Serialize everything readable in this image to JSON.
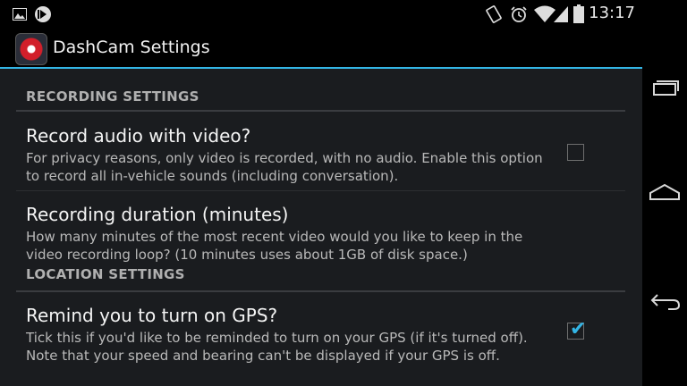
{
  "status_bar": {
    "time": "13:17",
    "left_icons": [
      "image-icon",
      "media-play-icon"
    ],
    "right_icons": [
      "vibrate-icon",
      "alarm-icon",
      "wifi-icon",
      "cell-signal-icon",
      "battery-icon"
    ]
  },
  "action_bar": {
    "title": "DashCam Settings",
    "accent_color": "#33b5e5"
  },
  "sections": {
    "recording": {
      "header": "RECORDING SETTINGS",
      "record_audio": {
        "title": "Record audio with video?",
        "summary": "For privacy reasons, only video is recorded, with no audio. Enable this option to record all in-vehicle sounds (including conversation).",
        "checked": false
      },
      "duration": {
        "title": "Recording duration (minutes)",
        "summary": "How many minutes of the most recent video would you like to keep in the video recording loop? (10 minutes uses about 1GB of disk space.)"
      }
    },
    "location": {
      "header": "LOCATION SETTINGS",
      "gps": {
        "title": "Remind you to turn on GPS?",
        "summary": "Tick this if you'd like to be reminded to turn on your GPS (if it's turned off). Note that your speed and bearing can't be displayed if your GPS is off.",
        "checked": true
      }
    }
  },
  "nav_bar": {
    "buttons": [
      "recent-apps-icon",
      "home-icon",
      "back-icon"
    ]
  }
}
